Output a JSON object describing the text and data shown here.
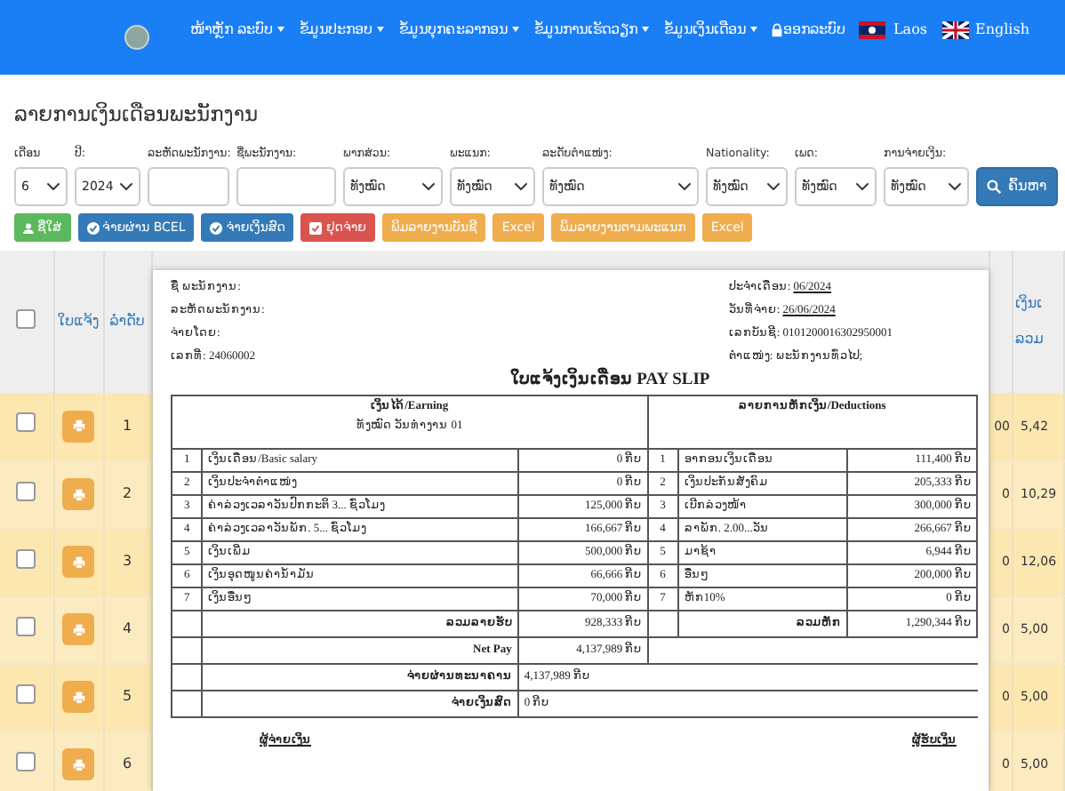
{
  "navbar": {
    "menu": [
      {
        "label": "ໜ້າຫຼັກ ລະບົບ",
        "dropdown": true
      },
      {
        "label": "ຂໍ້ມູນປະກອບ",
        "dropdown": true
      },
      {
        "label": "ຂໍ້ມູນບຸກຄະລາກອນ",
        "dropdown": true
      },
      {
        "label": "ຂໍ້ມູນການເຮັດວຽກ",
        "dropdown": true
      },
      {
        "label": "ຂໍ້ມູນເງິນເດືອນ",
        "dropdown": true
      }
    ],
    "logout": "ອອກລະບົບ",
    "languages": [
      {
        "label": "Laos",
        "kind": "lao"
      },
      {
        "label": "English",
        "kind": "english"
      }
    ]
  },
  "page_title": "ລາຍການເງິນເດືອນພະນັກງານ",
  "filters": [
    {
      "label": "ເດືອນ",
      "kind": "select",
      "value": "6"
    },
    {
      "label": "ປີ:",
      "kind": "select",
      "value": "2024"
    },
    {
      "label": "ລະຫັດພະນັກງານ:",
      "kind": "input"
    },
    {
      "label": "ຊື່ພະນັກງານ:",
      "kind": "input"
    },
    {
      "label": "ພາກສ່ວນ:",
      "kind": "select",
      "value": "ທັງໝົດ"
    },
    {
      "label": "ພະແນກ:",
      "kind": "select",
      "value": "ທັງໝົດ"
    },
    {
      "label": "ລະດັບຕໍາແໜ່ງ:",
      "kind": "select",
      "value": "ທັງໝົດ"
    },
    {
      "label": "Nationality:",
      "kind": "select",
      "value": "ທັງໝົດ"
    },
    {
      "label": "ເພດ:",
      "kind": "select",
      "value": "ທັງໝົດ"
    },
    {
      "label": "ການຈ່າຍເງິນ:",
      "kind": "select",
      "value": "ທັງໝົດ"
    }
  ],
  "search_button": "ຄົ້ນຫາ",
  "actions": [
    {
      "label": "ຊື່ໃສ່",
      "kind": "add"
    },
    {
      "label": "ຈ່າຍຜ່ານ BCEL",
      "kind": "transfer"
    },
    {
      "label": "ຈ່າຍເງິນສົດ",
      "kind": "transfer"
    },
    {
      "label": "ຢຸດຈ່າຍ",
      "kind": "stop"
    },
    {
      "label": "ພິມລາຍງານບັນຊີ",
      "kind": "report"
    },
    {
      "label": "Excel",
      "kind": "report"
    },
    {
      "label": "ພິມລາຍງານຕາມພະແນກ",
      "kind": "report"
    },
    {
      "label": "Excel",
      "kind": "report"
    }
  ],
  "table": {
    "header_checked": false,
    "columns": [
      "ໃບແຈ້ງ",
      "ລໍາດັບ"
    ],
    "last_column": {
      "header": "ເງິນເ",
      "subheader": "ລວມ"
    },
    "rows": [
      {
        "checked": false,
        "number": "1",
        "column_a": "00",
        "column_b": "5,42"
      },
      {
        "checked": false,
        "number": "2",
        "column_a": "0",
        "column_b": "10,29"
      },
      {
        "checked": false,
        "number": "3",
        "column_a": "0",
        "column_b": "12,06"
      },
      {
        "checked": false,
        "number": "4",
        "column_a": "0",
        "column_b": "5,00"
      },
      {
        "checked": false,
        "number": "5",
        "column_a": "0",
        "column_b": "5,00"
      },
      {
        "checked": false,
        "number": "6",
        "column_a": "0",
        "column_b": "5,00"
      }
    ]
  },
  "payslip": {
    "info_left": [
      {
        "label": "ຊື່ ພະນັກງານ:"
      },
      {
        "label": "ລະຫັດພະນັກງານ:"
      },
      {
        "label": "ຈ່າຍໂດຍ:"
      },
      {
        "label": "ເລກທີ່:",
        "value": "24060002"
      }
    ],
    "info_right": [
      {
        "label": "ປະຈໍາເດືອນ:",
        "value": "06/2024",
        "underlined": true
      },
      {
        "label": "ວັນທີ່ຈ່າຍ:",
        "value": "26/06/2024",
        "underlined": true
      },
      {
        "label": "ເລກບັນຊີ:",
        "value": "0101200016302950001",
        "underlined": false
      },
      {
        "label": "ຕໍາແໜ່ງ:",
        "value": "ພະນັກງານທົ່ວໄປ;",
        "underlined": false
      }
    ],
    "title": "ໃບແຈ້ງເງິນເດືອນ PAY SLIP",
    "earnings_header": "ເງິນໄດ້/Earning",
    "earnings_subheader": "ທັງໝົດ ວັນທໍາງານ 01",
    "deductions_header": "ລາຍການຫັກເງິນ/Deductions",
    "earnings": [
      {
        "no": "1",
        "label": "ເງິນເດືອນ/Basic salary",
        "amount": "0 ກີບ"
      },
      {
        "no": "2",
        "label": "ເງິນປະຈໍາຕໍາແໜ່ງ",
        "amount": "0 ກີບ"
      },
      {
        "no": "3",
        "label": "ຄ່າລ່ວງເວລາວັນປົກກະຕິ 3... ຊົ່ວໂມງ",
        "amount": "125,000 ກີບ"
      },
      {
        "no": "4",
        "label": "ຄ່າລ່ວງເວລາວັນພັກ. 5... ຊົ່ວໂມງ",
        "amount": "166,667 ກີບ"
      },
      {
        "no": "5",
        "label": "ເງິນເພີ່ມ",
        "amount": "500,000 ກີບ"
      },
      {
        "no": "6",
        "label": "ເງິນອຸດໜູນຄ່ານໍ້າມັນ",
        "amount": "66,666 ກີບ"
      },
      {
        "no": "7",
        "label": "ເງິນອື່ນໆ",
        "amount": "70,000 ກີບ"
      }
    ],
    "deductions": [
      {
        "no": "1",
        "label": "ອາກອນເງິນເດືອນ",
        "amount": "111,400 ກີບ"
      },
      {
        "no": "2",
        "label": "ເງິນປະກັນສັງຄົມ",
        "amount": "205,333 ກີບ"
      },
      {
        "no": "3",
        "label": "ເບີກລ່ວງໜ້າ",
        "amount": "300,000 ກີບ"
      },
      {
        "no": "4",
        "label": "ລາພັກ. 2.00...ວັນ",
        "amount": "266,667 ກີບ"
      },
      {
        "no": "5",
        "label": "ມາຊ້າ",
        "amount": "6,944 ກີບ"
      },
      {
        "no": "6",
        "label": "ອື່ນໆ",
        "amount": "200,000 ກີບ"
      },
      {
        "no": "7",
        "label": "ຫັກ10%",
        "amount": "0 ກີບ"
      }
    ],
    "total_earnings": {
      "label": "ລວມລາຍຮັບ",
      "amount": "928,333 ກີບ"
    },
    "total_deductions": {
      "label": "ລວມຫັກ",
      "amount": "1,290,344 ກີບ"
    },
    "net_pay": {
      "label": "Net Pay",
      "amount": "4,137,989 ກີບ"
    },
    "payments": [
      {
        "label": "ຈ່າຍຜ່ານທະນາຄານ",
        "amount": "4,137,989 ກີບ"
      },
      {
        "label": "ຈ່າຍເງິນສົດ",
        "amount": "0 ກີບ"
      }
    ],
    "signatures": [
      "ຜູ້ຈ່າຍເງິນ",
      "ຜູ້ຮັບເງິນ"
    ]
  }
}
